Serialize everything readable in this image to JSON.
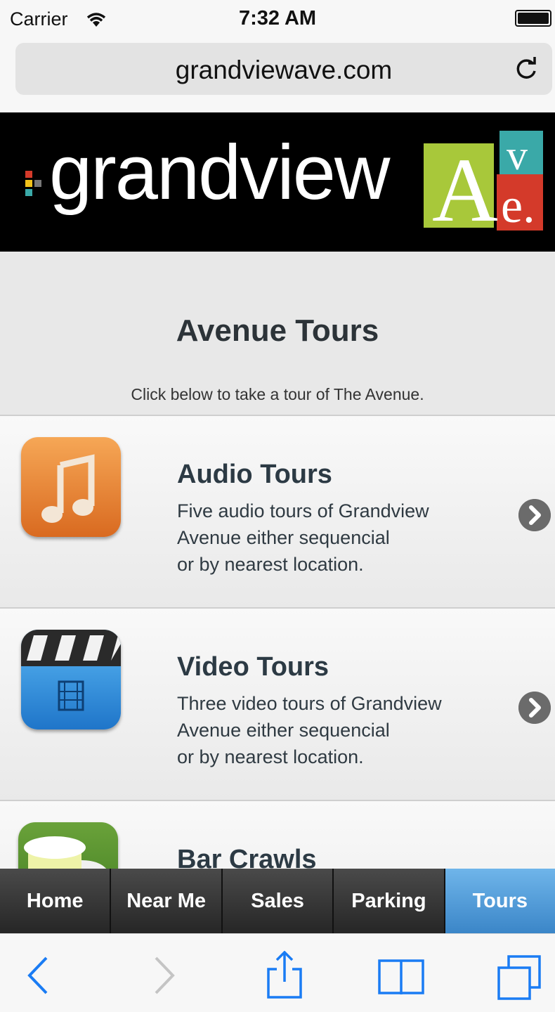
{
  "status_bar": {
    "carrier": "Carrier",
    "time": "7:32 AM",
    "wifi_icon": "wifi-icon",
    "battery_icon": "battery-icon"
  },
  "browser": {
    "url": "grandviewave.com",
    "reload_icon": "reload-icon"
  },
  "banner": {
    "logo_text": "grandview",
    "logo_mark": "Ave.",
    "colors": {
      "dot_red": "#d43a2a",
      "dot_yellow": "#f1c21b",
      "dot_teal": "#3aa9a8",
      "square_green": "#a8c83a",
      "square_teal": "#3aa9a8",
      "square_red": "#d43a2a"
    }
  },
  "page": {
    "title": "Avenue Tours",
    "subtitle": "Click below to take a tour of The Avenue."
  },
  "tours": [
    {
      "title": "Audio Tours",
      "desc": [
        "Five audio tours of Grandview",
        "Avenue either sequencial",
        "or by nearest location."
      ],
      "icon": "music-note-icon"
    },
    {
      "title": "Video Tours",
      "desc": [
        "Three video tours of Grandview",
        "Avenue either sequencial",
        "or by nearest location."
      ],
      "icon": "clapperboard-icon"
    },
    {
      "title": "Bar Crawls",
      "desc": [],
      "icon": "beer-mug-icon"
    }
  ],
  "tab_bar": {
    "tabs": [
      "Home",
      "Near Me",
      "Sales",
      "Parking",
      "Tours"
    ],
    "active": "Tours",
    "active_color": "#4a98d8"
  },
  "toolbar": {
    "icons": [
      "back-icon",
      "forward-icon",
      "share-icon",
      "bookmarks-icon",
      "tabs-icon"
    ],
    "accent": "#1a7cf4"
  }
}
